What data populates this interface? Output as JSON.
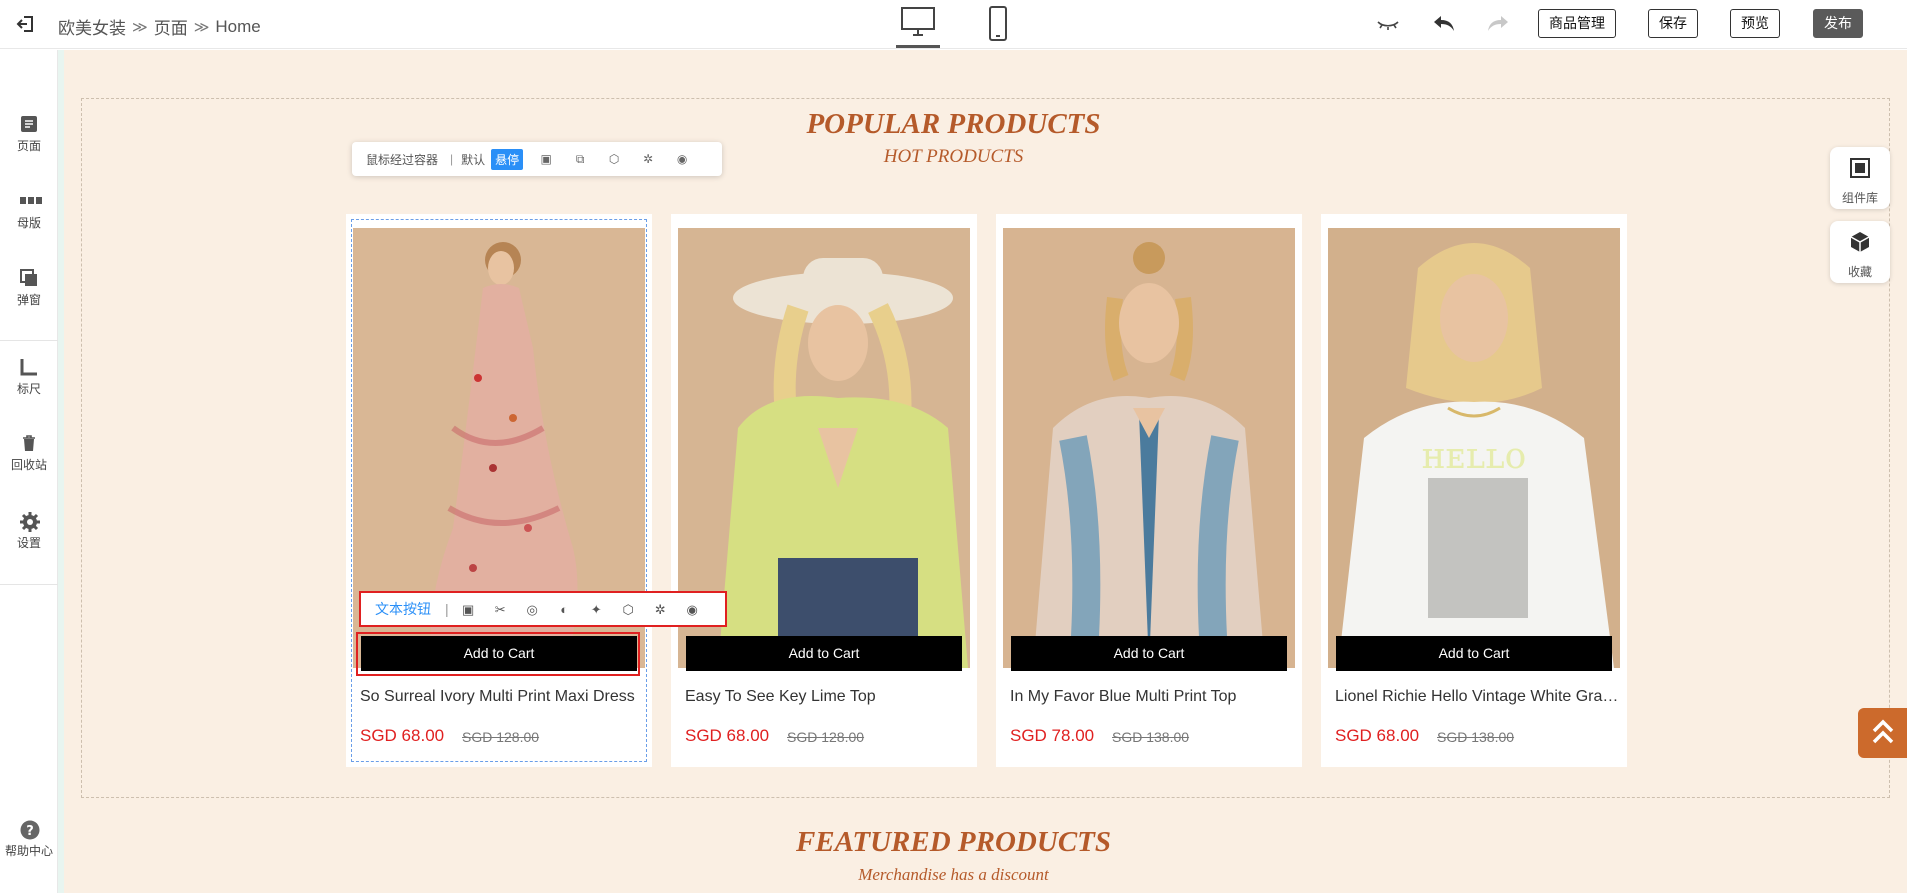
{
  "breadcrumb": [
    "欧美女装",
    "页面",
    "Home"
  ],
  "breadcrumb_sep": "≫",
  "toolbar": {
    "product_manage": "商品管理",
    "save": "保存",
    "preview": "预览",
    "publish": "发布"
  },
  "sidebar": {
    "items": [
      {
        "label": "页面",
        "icon": "page-icon"
      },
      {
        "label": "母版",
        "icon": "master-icon"
      },
      {
        "label": "弹窗",
        "icon": "popup-icon"
      },
      {
        "label": "标尺",
        "icon": "ruler-icon"
      },
      {
        "label": "回收站",
        "icon": "recycle-bin-icon"
      },
      {
        "label": "设置",
        "icon": "gear-icon"
      }
    ],
    "help": "帮助中心"
  },
  "section1": {
    "title": "POPULAR PRODUCTS",
    "subtitle": "HOT PRODUCTS"
  },
  "hover_bar": {
    "label": "鼠标经过容器",
    "default": "默认",
    "hover": "悬停"
  },
  "text_toolbar": {
    "label": "文本按钮"
  },
  "products": [
    {
      "name": "So Surreal Ivory Multi Print Maxi Dress",
      "price": "SGD 68.00",
      "original": "SGD 128.00",
      "cart": "Add to Cart"
    },
    {
      "name": "Easy To See Key Lime Top",
      "price": "SGD 68.00",
      "original": "SGD 128.00",
      "cart": "Add to Cart"
    },
    {
      "name": "In My Favor Blue Multi Print Top",
      "price": "SGD 78.00",
      "original": "SGD 138.00",
      "cart": "Add to Cart"
    },
    {
      "name": "Lionel Richie Hello Vintage White Graphic Tee",
      "price": "SGD 68.00",
      "original": "SGD 138.00",
      "cart": "Add to Cart"
    }
  ],
  "section2": {
    "title": "FEATURED PRODUCTS",
    "subtitle": "Merchandise has a discount"
  },
  "right_panel": {
    "components": "组件库",
    "favorites": "收藏"
  },
  "colors": {
    "accent": "#b55a2a",
    "price": "#e02020",
    "canvas_bg": "#faefe3",
    "selection": "#e02020",
    "highlight": "#2a8ff7"
  }
}
